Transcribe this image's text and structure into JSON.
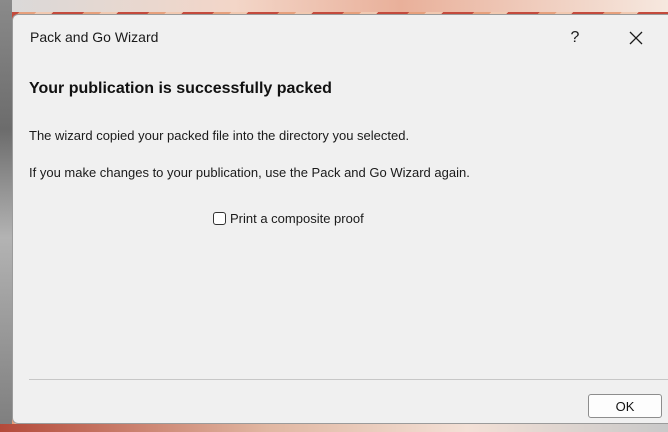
{
  "window": {
    "title": "Pack and Go Wizard",
    "help_label": "?",
    "close_icon": "close-icon"
  },
  "content": {
    "heading": "Your publication is successfully packed",
    "message_1": "The wizard copied your packed file into the directory you selected.",
    "message_2": "If you make changes to your publication, use the Pack and Go Wizard again.",
    "checkbox": {
      "label": "Print a composite proof",
      "checked": false
    }
  },
  "footer": {
    "ok_label": "OK"
  }
}
